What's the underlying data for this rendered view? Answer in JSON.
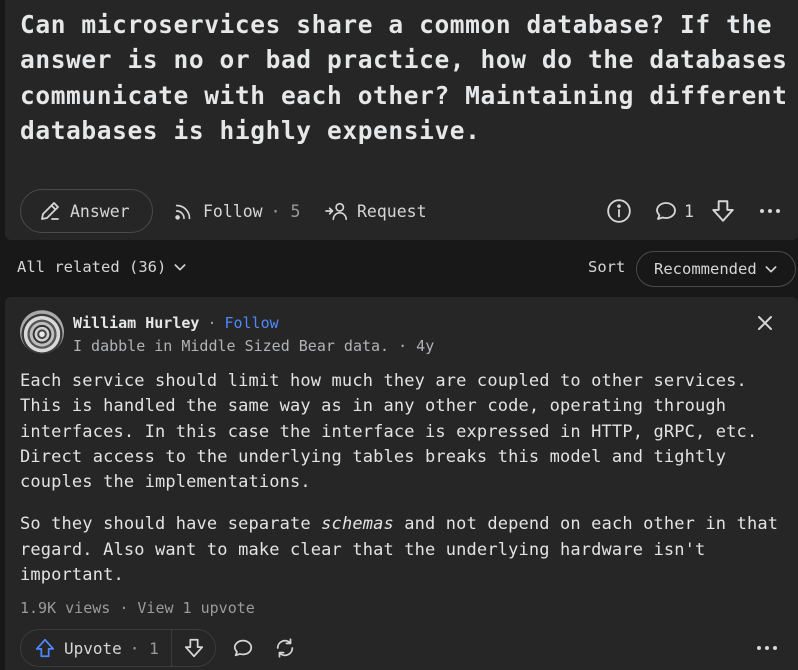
{
  "question": {
    "title": "Can microservices share a common database? If the answer is no or bad practice, how do the databases communicate with each other? Maintaining different databases is highly expensive.",
    "answer_label": "Answer",
    "follow_label": "Follow",
    "follow_count": "· 5",
    "request_label": "Request",
    "comment_count": "1"
  },
  "filter": {
    "all_related": "All related (36)",
    "sort_label": "Sort",
    "sort_value": "Recommended"
  },
  "answer": {
    "author_name": "William Hurley",
    "follow_sep": "·",
    "follow_label": "Follow",
    "credential": "I dabble in Middle Sized Bear data. · 4y",
    "paragraph1": "Each service should limit how much they are coupled to other services. This is handled the same way as in any other code, operating through interfaces. In this case the interface is expressed in HTTP, gRPC, etc. Direct access to the underlying tables breaks this model and tightly couples the implementations.",
    "p2_before": "So they should have separate ",
    "p2_em": "schemas",
    "p2_after": " and not depend on each other in that regard. Also want to make clear that the underlying hardware isn't important.",
    "stats": "1.9K views · View 1 upvote",
    "upvote_label": "Upvote",
    "upvote_count": "· 1"
  },
  "icons": [
    "pencil-icon",
    "follow-signal-icon",
    "request-person-icon",
    "info-icon",
    "comment-icon",
    "downvote-icon",
    "more-icon",
    "chevron-down-icon",
    "close-icon",
    "upvote-icon",
    "share-icon"
  ],
  "colors": {
    "background": "#181818",
    "card": "#262626",
    "accent_follow": "#4d88ff",
    "upvote_blue": "#4d88ff"
  }
}
